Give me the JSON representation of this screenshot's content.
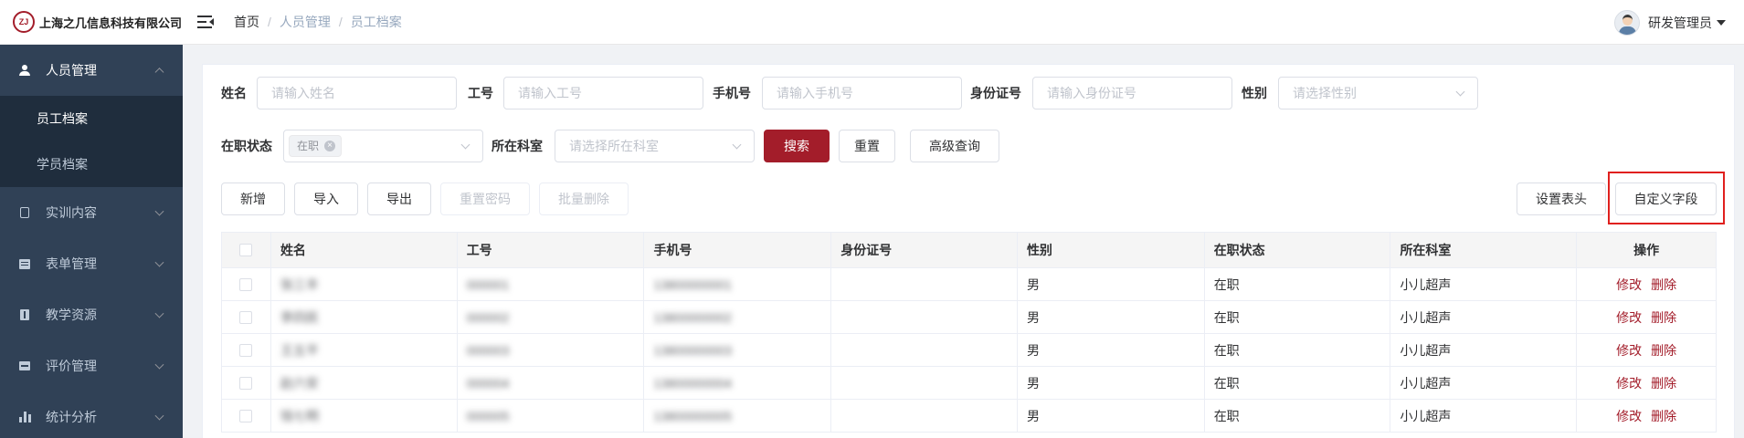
{
  "header": {
    "logo_text": "ZJ",
    "brand_name": "上海之几信息科技有限公司",
    "breadcrumb": {
      "home": "首页",
      "level1": "人员管理",
      "level2": "员工档案"
    },
    "user": {
      "name": "研发管理员"
    }
  },
  "sidebar": {
    "groups": [
      {
        "label": "人员管理",
        "icon": "user-icon",
        "open": true,
        "items": [
          {
            "label": "员工档案",
            "active": true
          },
          {
            "label": "学员档案",
            "active": false
          }
        ]
      },
      {
        "label": "实训内容",
        "icon": "training-icon"
      },
      {
        "label": "表单管理",
        "icon": "form-icon"
      },
      {
        "label": "教学资源",
        "icon": "book-icon"
      },
      {
        "label": "评价管理",
        "icon": "evaluation-icon"
      },
      {
        "label": "统计分析",
        "icon": "stats-icon"
      }
    ]
  },
  "filters": {
    "name": {
      "label": "姓名",
      "placeholder": "请输入姓名"
    },
    "emp_no": {
      "label": "工号",
      "placeholder": "请输入工号"
    },
    "phone": {
      "label": "手机号",
      "placeholder": "请输入手机号"
    },
    "id_card": {
      "label": "身份证号",
      "placeholder": "请输入身份证号"
    },
    "gender": {
      "label": "性别",
      "placeholder": "请选择性别"
    },
    "status": {
      "label": "在职状态",
      "selected_tag": "在职",
      "tag_close": "×"
    },
    "dept": {
      "label": "所在科室",
      "placeholder": "请选择所在科室"
    },
    "search_button": "搜索",
    "reset_button": "重置",
    "advanced_button": "高级查询"
  },
  "toolbar": {
    "add": "新增",
    "import": "导入",
    "export": "导出",
    "reset_password": "重置密码",
    "batch_delete": "批量删除",
    "set_header": "设置表头",
    "custom_fields": "自定义字段"
  },
  "table": {
    "columns": [
      "姓名",
      "工号",
      "手机号",
      "身份证号",
      "性别",
      "在职状态",
      "所在科室",
      "操作"
    ],
    "rows": [
      {
        "name": "张三丰",
        "emp_no": "000001",
        "phone": "13800000001",
        "id_card": "",
        "gender": "男",
        "status": "在职",
        "dept": "小儿超声"
      },
      {
        "name": "李四民",
        "emp_no": "000002",
        "phone": "13800000002",
        "id_card": "",
        "gender": "男",
        "status": "在职",
        "dept": "小儿超声"
      },
      {
        "name": "王五平",
        "emp_no": "000003",
        "phone": "13800000003",
        "id_card": "",
        "gender": "男",
        "status": "在职",
        "dept": "小儿超声"
      },
      {
        "name": "赵六安",
        "emp_no": "000004",
        "phone": "13800000004",
        "id_card": "",
        "gender": "男",
        "status": "在职",
        "dept": "小儿超声"
      },
      {
        "name": "钱七明",
        "emp_no": "000005",
        "phone": "13800000005",
        "id_card": "",
        "gender": "男",
        "status": "在职",
        "dept": "小儿超声"
      }
    ],
    "edit_link": "修改",
    "delete_link": "删除"
  },
  "colors": {
    "primary": "#a31d2a",
    "sidebar_bg": "#304156",
    "submenu_bg": "#1f2d3d",
    "highlight": "#e0201e"
  }
}
